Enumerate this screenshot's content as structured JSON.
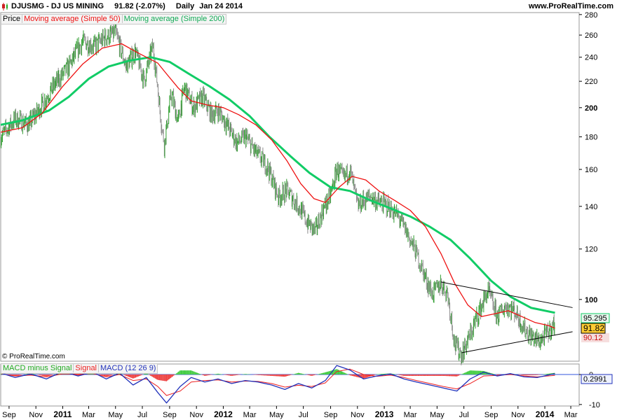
{
  "header": {
    "symbol_line": "DJUSMG - DJ US MINING",
    "quote": "91.82 (-2.07%)",
    "period": "Daily",
    "date": "Jan 24 2014",
    "website": "www.ProRealTime.com",
    "icon": "candlestick-icon"
  },
  "legend_price": {
    "price": "Price",
    "ma50": "Moving average (Simple 50)",
    "ma200": "Moving average (Simple 200)"
  },
  "legend_macd": {
    "hist": "MACD minus Signal",
    "signal": "Signal",
    "macd": "MACD (12 26 9)"
  },
  "copyright": "© ProRealTime.com",
  "colors": {
    "price_up": "#2e9e2e",
    "price_down": "#8a8a8a",
    "ma50": "#ee1111",
    "ma200": "#11cc66",
    "macd": "#2233bb",
    "signal": "#ee2222",
    "hist_pos": "#44cc44",
    "hist_neg": "#ee4444",
    "badge_ma200": "#e8f7ee",
    "badge_price": "#ffcc33"
  },
  "chart_data": [
    {
      "type": "line",
      "log_scale": true,
      "ylim": [
        80,
        282
      ],
      "x_range": [
        "2010-08-13",
        "2014-03-20"
      ],
      "y_ticks": [
        280,
        260,
        240,
        220,
        200,
        180,
        160,
        140,
        120,
        100
      ],
      "x_ticks": [
        "Sep",
        "Nov",
        "2011",
        "Mar",
        "May",
        "Jul",
        "Sep",
        "Nov",
        "2012",
        "Mar",
        "May",
        "Jul",
        "Sep",
        "Nov",
        "2013",
        "Mar",
        "May",
        "Jul",
        "Sep",
        "Nov",
        "2014",
        "Mar"
      ],
      "x_tick_dates": [
        "2010-09-01",
        "2010-11-01",
        "2011-01-01",
        "2011-03-01",
        "2011-05-01",
        "2011-07-01",
        "2011-09-01",
        "2011-11-01",
        "2012-01-01",
        "2012-03-01",
        "2012-05-01",
        "2012-07-01",
        "2012-09-01",
        "2012-11-01",
        "2013-01-01",
        "2013-03-01",
        "2013-05-01",
        "2013-07-01",
        "2013-09-01",
        "2013-11-01",
        "2014-01-01",
        "2014-03-01"
      ],
      "last_values": {
        "ma200": "95.295",
        "price": "91.82",
        "ma50": "90.12"
      },
      "series": [
        {
          "name": "Price",
          "x": [
            "2010-08-13",
            "2010-09-15",
            "2010-10-15",
            "2010-11-15",
            "2010-12-15",
            "2011-01-15",
            "2011-02-15",
            "2011-03-15",
            "2011-04-08",
            "2011-05-01",
            "2011-05-25",
            "2011-06-15",
            "2011-07-05",
            "2011-07-25",
            "2011-08-12",
            "2011-08-20",
            "2011-09-05",
            "2011-09-20",
            "2011-10-05",
            "2011-10-25",
            "2011-11-15",
            "2011-12-05",
            "2011-12-20",
            "2012-01-10",
            "2012-02-01",
            "2012-02-20",
            "2012-03-15",
            "2012-04-10",
            "2012-05-05",
            "2012-05-25",
            "2012-06-20",
            "2012-07-10",
            "2012-07-28",
            "2012-08-15",
            "2012-09-01",
            "2012-09-15",
            "2012-10-01",
            "2012-10-15",
            "2012-11-01",
            "2012-11-15",
            "2012-12-01",
            "2012-12-20",
            "2013-01-10",
            "2013-02-01",
            "2013-02-20",
            "2013-03-15",
            "2013-04-05",
            "2013-04-20",
            "2013-05-10",
            "2013-05-25",
            "2013-06-10",
            "2013-06-26",
            "2013-07-15",
            "2013-08-05",
            "2013-08-25",
            "2013-09-15",
            "2013-10-05",
            "2013-10-25",
            "2013-11-15",
            "2013-12-05",
            "2013-12-20",
            "2014-01-10",
            "2014-01-24"
          ],
          "y": [
            180,
            192,
            188,
            202,
            218,
            232,
            254,
            250,
            258,
            262,
            232,
            245,
            220,
            250,
            192,
            175,
            210,
            190,
            215,
            200,
            208,
            195,
            198,
            188,
            176,
            180,
            170,
            162,
            145,
            148,
            140,
            132,
            128,
            138,
            146,
            160,
            155,
            160,
            140,
            143,
            145,
            142,
            140,
            135,
            128,
            118,
            108,
            102,
            106,
            102,
            85,
            82,
            88,
            96,
            103,
            94,
            98,
            96,
            90,
            87,
            86,
            89,
            91.82
          ]
        },
        {
          "name": "Moving average (Simple 50)",
          "x": [
            "2010-08-13",
            "2010-10-01",
            "2010-11-15",
            "2011-01-01",
            "2011-02-15",
            "2011-04-01",
            "2011-05-15",
            "2011-06-20",
            "2011-08-05",
            "2011-08-25",
            "2011-09-20",
            "2011-10-20",
            "2011-11-25",
            "2012-01-01",
            "2012-02-05",
            "2012-03-15",
            "2012-04-20",
            "2012-05-25",
            "2012-06-25",
            "2012-07-25",
            "2012-08-20",
            "2012-09-20",
            "2012-10-20",
            "2012-11-20",
            "2012-12-20",
            "2013-01-25",
            "2013-03-01",
            "2013-04-05",
            "2013-05-10",
            "2013-06-10",
            "2013-07-10",
            "2013-08-10",
            "2013-09-10",
            "2013-10-10",
            "2013-11-10",
            "2013-12-10",
            "2014-01-10",
            "2014-01-24"
          ],
          "y": [
            183,
            186,
            196,
            216,
            234,
            248,
            252,
            244,
            235,
            226,
            215,
            205,
            202,
            200,
            195,
            188,
            178,
            165,
            152,
            144,
            142,
            150,
            156,
            154,
            148,
            143,
            138,
            130,
            118,
            106,
            98,
            94,
            95,
            96,
            94,
            92,
            91,
            90.12
          ]
        },
        {
          "name": "Moving average (Simple 200)",
          "x": [
            "2010-08-13",
            "2010-10-01",
            "2010-12-01",
            "2011-01-15",
            "2011-03-01",
            "2011-04-15",
            "2011-06-01",
            "2011-07-20",
            "2011-09-01",
            "2011-10-15",
            "2011-12-01",
            "2012-01-15",
            "2012-03-01",
            "2012-04-15",
            "2012-06-01",
            "2012-07-15",
            "2012-09-01",
            "2012-10-15",
            "2012-12-01",
            "2013-01-15",
            "2013-03-01",
            "2013-04-15",
            "2013-06-01",
            "2013-07-15",
            "2013-09-01",
            "2013-10-15",
            "2013-12-01",
            "2014-01-24"
          ],
          "y": [
            188,
            191,
            198,
            208,
            222,
            232,
            237,
            240,
            236,
            226,
            216,
            206,
            194,
            180,
            168,
            158,
            150,
            148,
            143,
            139,
            135,
            130,
            124,
            116,
            107,
            101,
            97,
            95.295
          ]
        }
      ]
    },
    {
      "type": "area",
      "title": "MACD (12 26 9)",
      "ylim": [
        -10.5,
        3.5
      ],
      "y_ticks": [
        0,
        -10
      ],
      "last_value": "0.2991",
      "series": [
        {
          "name": "MACD (12 26 9)",
          "x": [
            "2010-08-13",
            "2010-09-15",
            "2010-10-20",
            "2010-11-25",
            "2011-01-01",
            "2011-02-05",
            "2011-03-10",
            "2011-04-10",
            "2011-05-10",
            "2011-06-10",
            "2011-07-10",
            "2011-08-05",
            "2011-08-25",
            "2011-09-25",
            "2011-10-20",
            "2011-11-20",
            "2011-12-20",
            "2012-01-20",
            "2012-02-20",
            "2012-03-20",
            "2012-04-20",
            "2012-05-20",
            "2012-06-20",
            "2012-07-20",
            "2012-08-20",
            "2012-09-15",
            "2012-10-15",
            "2012-11-15",
            "2012-12-15",
            "2013-01-15",
            "2013-02-15",
            "2013-03-15",
            "2013-04-15",
            "2013-05-15",
            "2013-06-15",
            "2013-07-15",
            "2013-08-15",
            "2013-09-15",
            "2013-10-15",
            "2013-11-15",
            "2013-12-15",
            "2014-01-24"
          ],
          "y": [
            0.5,
            -1.0,
            0.2,
            -1.5,
            1.0,
            -0.5,
            0.8,
            -1.5,
            0.5,
            -3.5,
            -1.0,
            -6.0,
            -9.5,
            -4.0,
            -1.0,
            -2.5,
            -1.5,
            -3.0,
            -2.0,
            -2.5,
            -3.5,
            -5.0,
            -3.0,
            -4.5,
            -2.0,
            3.0,
            1.5,
            -1.5,
            -0.5,
            0.2,
            -1.5,
            -2.5,
            -3.5,
            -4.5,
            -5.5,
            -1.5,
            0.8,
            -0.5,
            0.3,
            -0.8,
            -1.0,
            0.2991
          ]
        },
        {
          "name": "Signal",
          "x": [
            "2010-08-13",
            "2010-09-15",
            "2010-10-20",
            "2010-11-25",
            "2011-01-01",
            "2011-02-05",
            "2011-03-10",
            "2011-04-10",
            "2011-05-10",
            "2011-06-10",
            "2011-07-10",
            "2011-08-05",
            "2011-08-25",
            "2011-09-25",
            "2011-10-20",
            "2011-11-20",
            "2011-12-20",
            "2012-01-20",
            "2012-02-20",
            "2012-03-20",
            "2012-04-20",
            "2012-05-20",
            "2012-06-20",
            "2012-07-20",
            "2012-08-20",
            "2012-09-15",
            "2012-10-15",
            "2012-11-15",
            "2012-12-15",
            "2013-01-15",
            "2013-02-15",
            "2013-03-15",
            "2013-04-15",
            "2013-05-15",
            "2013-06-15",
            "2013-07-15",
            "2013-08-15",
            "2013-09-15",
            "2013-10-15",
            "2013-11-15",
            "2013-12-15",
            "2014-01-24"
          ],
          "y": [
            0.3,
            -0.5,
            -0.2,
            -0.8,
            0.2,
            0.1,
            0.3,
            -0.8,
            0.0,
            -2.0,
            -1.5,
            -4.0,
            -7.0,
            -5.5,
            -2.5,
            -2.0,
            -1.8,
            -2.5,
            -2.2,
            -2.3,
            -3.0,
            -4.2,
            -3.6,
            -4.0,
            -2.8,
            1.0,
            1.8,
            0.0,
            -0.6,
            -0.2,
            -1.0,
            -2.0,
            -3.0,
            -4.0,
            -4.8,
            -3.0,
            -0.5,
            -0.3,
            0.0,
            -0.5,
            -0.8,
            -0.3
          ]
        }
      ]
    }
  ]
}
